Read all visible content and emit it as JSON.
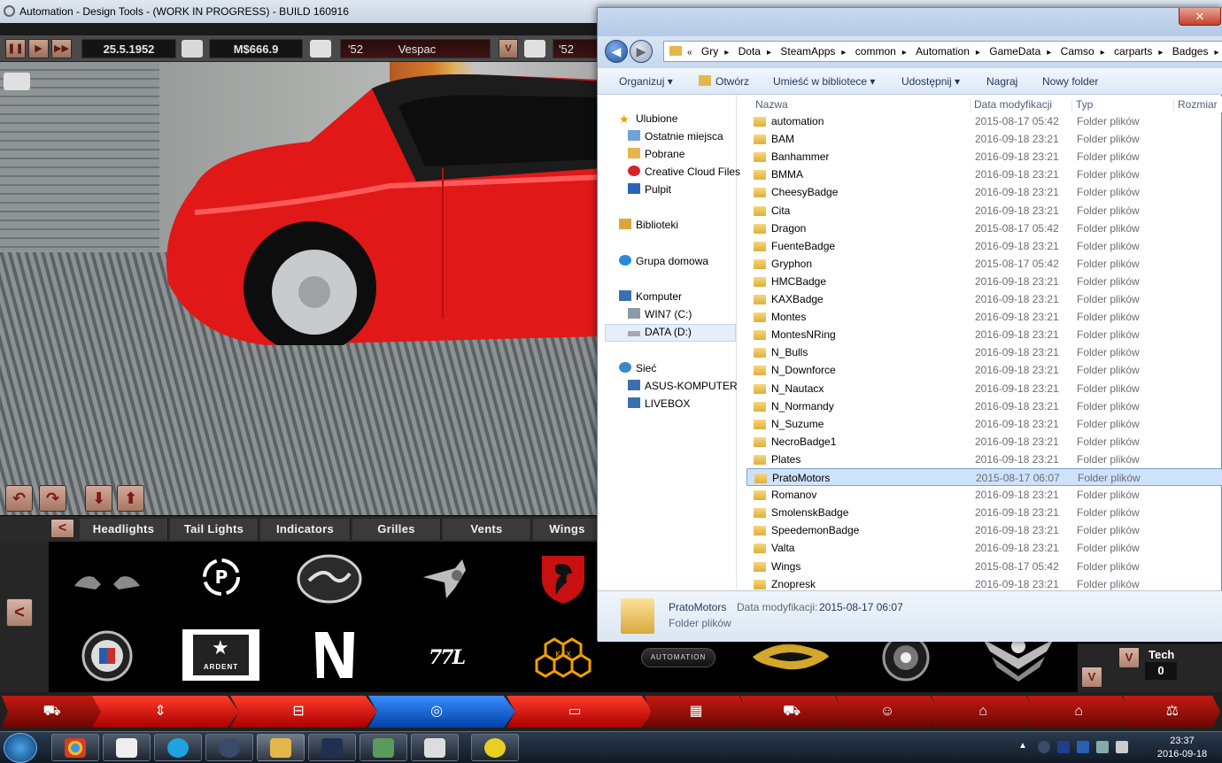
{
  "game": {
    "window_title": "Automation - Design Tools - (WORK IN PROGRESS) - BUILD 160916",
    "date": "25.5.1952",
    "money": "M$666.9",
    "model_year": "'52",
    "model_name": "Vespac",
    "trim_year": "'52",
    "dropdown_label": "V",
    "categories": [
      "Headlights",
      "Tail Lights",
      "Indicators",
      "Grilles",
      "Vents",
      "Wings"
    ],
    "category_scroll_left": "<",
    "grid_scroll_left": "<",
    "scroll_down": "V",
    "tech_label": "Tech",
    "tech_value": "0",
    "badge_text_ardent": "ARDENT",
    "badge_text_automation": "AUTOMATION",
    "badge_text_77": "77L",
    "badge_text_kax": "KAX"
  },
  "explorer": {
    "address": [
      "Gry",
      "Dota",
      "SteamApps",
      "common",
      "Automation",
      "GameData",
      "Camso",
      "carparts",
      "Badges"
    ],
    "address_prefix": "«",
    "commands": [
      "Organizuj",
      "Otwórz",
      "Umieść w bibliotece",
      "Udostępnij",
      "Nagraj",
      "Nowy folder"
    ],
    "nav": {
      "favorites": "Ulubione",
      "favorites_items": [
        "Ostatnie miejsca",
        "Pobrane",
        "Creative Cloud Files",
        "Pulpit"
      ],
      "libraries": "Biblioteki",
      "homegroup": "Grupa domowa",
      "computer": "Komputer",
      "computer_items": [
        "WIN7 (C:)",
        "DATA (D:)"
      ],
      "network": "Sieć",
      "network_items": [
        "ASUS-KOMPUTER",
        "LIVEBOX"
      ]
    },
    "columns": [
      "Nazwa",
      "Data modyfikacji",
      "Typ",
      "Rozmiar"
    ],
    "files": [
      {
        "name": "automation",
        "date": "2015-08-17 05:42",
        "type": "Folder plików"
      },
      {
        "name": "BAM",
        "date": "2016-09-18 23:21",
        "type": "Folder plików"
      },
      {
        "name": "Banhammer",
        "date": "2016-09-18 23:21",
        "type": "Folder plików"
      },
      {
        "name": "BMMA",
        "date": "2016-09-18 23:21",
        "type": "Folder plików"
      },
      {
        "name": "CheesyBadge",
        "date": "2016-09-18 23:21",
        "type": "Folder plików"
      },
      {
        "name": "Cita",
        "date": "2016-09-18 23:21",
        "type": "Folder plików"
      },
      {
        "name": "Dragon",
        "date": "2015-08-17 05:42",
        "type": "Folder plików"
      },
      {
        "name": "FuenteBadge",
        "date": "2016-09-18 23:21",
        "type": "Folder plików"
      },
      {
        "name": "Gryphon",
        "date": "2015-08-17 05:42",
        "type": "Folder plików"
      },
      {
        "name": "HMCBadge",
        "date": "2016-09-18 23:21",
        "type": "Folder plików"
      },
      {
        "name": "KAXBadge",
        "date": "2016-09-18 23:21",
        "type": "Folder plików"
      },
      {
        "name": "Montes",
        "date": "2016-09-18 23:21",
        "type": "Folder plików"
      },
      {
        "name": "MontesNRing",
        "date": "2016-09-18 23:21",
        "type": "Folder plików"
      },
      {
        "name": "N_Bulls",
        "date": "2016-09-18 23:21",
        "type": "Folder plików"
      },
      {
        "name": "N_Downforce",
        "date": "2016-09-18 23:21",
        "type": "Folder plików"
      },
      {
        "name": "N_Nautacx",
        "date": "2016-09-18 23:21",
        "type": "Folder plików"
      },
      {
        "name": "N_Normandy",
        "date": "2016-09-18 23:21",
        "type": "Folder plików"
      },
      {
        "name": "N_Suzume",
        "date": "2016-09-18 23:21",
        "type": "Folder plików"
      },
      {
        "name": "NecroBadge1",
        "date": "2016-09-18 23:21",
        "type": "Folder plików"
      },
      {
        "name": "Plates",
        "date": "2016-09-18 23:21",
        "type": "Folder plików"
      },
      {
        "name": "PratoMotors",
        "date": "2015-08-17 06:07",
        "type": "Folder plików",
        "selected": true
      },
      {
        "name": "Romanov",
        "date": "2016-09-18 23:21",
        "type": "Folder plików"
      },
      {
        "name": "SmolenskBadge",
        "date": "2016-09-18 23:21",
        "type": "Folder plików"
      },
      {
        "name": "SpeedemonBadge",
        "date": "2016-09-18 23:21",
        "type": "Folder plików"
      },
      {
        "name": "Valta",
        "date": "2016-09-18 23:21",
        "type": "Folder plików"
      },
      {
        "name": "Wings",
        "date": "2015-08-17 05:42",
        "type": "Folder plików"
      },
      {
        "name": "Znopresk",
        "date": "2016-09-18 23:21",
        "type": "Folder plików"
      }
    ],
    "details": {
      "name": "PratoMotors",
      "date_label": "Data modyfikacji:",
      "date_value": "2015-08-17 06:07",
      "type": "Folder plików"
    }
  },
  "taskbar": {
    "time": "23:37",
    "date": "2016-09-18"
  },
  "colors": {
    "step_red": "#d81a10",
    "step_blue": "#1e6fe0",
    "selection": "#cde3fb"
  }
}
